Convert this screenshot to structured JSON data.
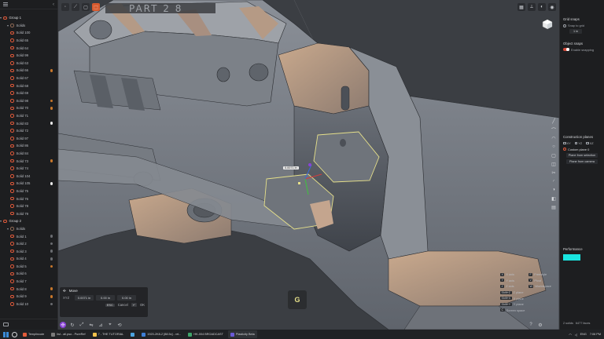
{
  "sidebar": {
    "items": [
      {
        "kind": "group",
        "label": "Group 1",
        "dot": null
      },
      {
        "kind": "sub",
        "label": "Solids",
        "dot": null
      },
      {
        "kind": "solid",
        "label": "Solid 100",
        "dot": null
      },
      {
        "kind": "solid",
        "label": "Solid 65",
        "dot": null
      },
      {
        "kind": "solid",
        "label": "Solid 64",
        "dot": null
      },
      {
        "kind": "solid",
        "label": "Solid 99",
        "dot": null
      },
      {
        "kind": "solid",
        "label": "Solid 63",
        "dot": null
      },
      {
        "kind": "solid",
        "label": "Solid 66",
        "dot": "orange"
      },
      {
        "kind": "solid",
        "label": "Solid 67",
        "dot": null
      },
      {
        "kind": "solid",
        "label": "Solid 68",
        "dot": null
      },
      {
        "kind": "solid",
        "label": "Solid 69",
        "dot": null
      },
      {
        "kind": "solid",
        "label": "Solid 98",
        "dot": "orange"
      },
      {
        "kind": "solid",
        "label": "Solid 70",
        "dot": "orange"
      },
      {
        "kind": "solid",
        "label": "Solid 71",
        "dot": null
      },
      {
        "kind": "solid",
        "label": "Solid 83",
        "dot": "white"
      },
      {
        "kind": "solid",
        "label": "Solid 72",
        "dot": null
      },
      {
        "kind": "solid",
        "label": "Solid 97",
        "dot": null
      },
      {
        "kind": "solid",
        "label": "Solid 86",
        "dot": null
      },
      {
        "kind": "solid",
        "label": "Solid 84",
        "dot": null
      },
      {
        "kind": "solid",
        "label": "Solid 73",
        "dot": "orange"
      },
      {
        "kind": "solid",
        "label": "Solid 74",
        "dot": null
      },
      {
        "kind": "solid",
        "label": "Solid 104",
        "dot": null
      },
      {
        "kind": "solid",
        "label": "Solid 105",
        "dot": "white"
      },
      {
        "kind": "solid",
        "label": "Solid 75",
        "dot": null
      },
      {
        "kind": "solid",
        "label": "Solid 76",
        "dot": null
      },
      {
        "kind": "solid",
        "label": "Solid 78",
        "dot": null
      },
      {
        "kind": "solid",
        "label": "Solid 79",
        "dot": null
      },
      {
        "kind": "group",
        "label": "Group 2",
        "dot": null
      },
      {
        "kind": "sub",
        "label": "Solids",
        "dot": null
      },
      {
        "kind": "solid",
        "label": "Solid 1",
        "dot": "grey"
      },
      {
        "kind": "solid",
        "label": "Solid 2",
        "dot": "grey"
      },
      {
        "kind": "solid",
        "label": "Solid 3",
        "dot": "grey"
      },
      {
        "kind": "solid",
        "label": "Solid 4",
        "dot": "grey"
      },
      {
        "kind": "solid",
        "label": "Solid 5",
        "dot": "orange"
      },
      {
        "kind": "solid",
        "label": "Solid 6",
        "dot": null
      },
      {
        "kind": "solid",
        "label": "Solid 7",
        "dot": null
      },
      {
        "kind": "solid",
        "label": "Solid 8",
        "dot": "orange"
      },
      {
        "kind": "solid",
        "label": "Solid 9",
        "dot": "orange"
      },
      {
        "kind": "solid",
        "label": "Solid 10",
        "dot": "grey"
      }
    ]
  },
  "viewport": {
    "title": "PART 2 8",
    "dimension_label": "0.0071 in",
    "g_key": "G"
  },
  "move_panel": {
    "title": "Move",
    "axis_label": "XYZ",
    "x_value": "0.0071 in",
    "y_value": "0.00 in",
    "z_value": "0.00 in",
    "cancel_key": "ESC",
    "cancel_label": "Cancel",
    "ok_key": "↵",
    "ok_label": "OK"
  },
  "shortcuts": [
    {
      "k1": "X",
      "l1": "X axis",
      "k2": "F",
      "l2": "Freestyle"
    },
    {
      "k1": "Y",
      "l1": "Y axis",
      "k2": "V",
      "l2": "Pivot"
    },
    {
      "k1": "Z",
      "l1": "Z axis",
      "k2": "W",
      "l2": "Worldspace"
    },
    {
      "k1": "Shift+Z",
      "l1": "Z plane",
      "k2": "",
      "l2": ""
    },
    {
      "k1": "Shift+X",
      "l1": "X plane",
      "k2": "",
      "l2": ""
    },
    {
      "k1": "Shift+Y",
      "l1": "Y plane",
      "k2": "",
      "l2": ""
    },
    {
      "k1": "C",
      "l1": "Screen space",
      "k2": "",
      "l2": ""
    }
  ],
  "right_panel": {
    "grid_snaps_title": "Grid snaps",
    "snap_to_grid_label": "Snap to grid",
    "grid_size": "1 in",
    "object_snaps_title": "Object snaps",
    "enable_snapping_label": "Enable snapping",
    "construction_planes_title": "Construction planes",
    "plane_x": "XY",
    "plane_y": "YZ",
    "plane_z": "XZ",
    "custom_plane_label": "Custom plane 0",
    "plane_from_selection": "Plane from selection",
    "plane_from_camera": "Plane from camera",
    "performance_title": "Performance",
    "footer_solids": "2 solids",
    "footer_faces": "6477 faces"
  },
  "taskbar": {
    "apps": [
      {
        "label": "Templincute",
        "color": "#e25c3a",
        "active": false
      },
      {
        "label": "list - all.pso - PureRef",
        "color": "#7a7a7a",
        "active": false
      },
      {
        "label": "7 - THE TUTORIAL",
        "color": "#f2c24b",
        "active": false
      },
      {
        "label": "",
        "color": "#4aa3df",
        "active": false
      },
      {
        "label": "1920-2K8-2 [88.5c] - vrt...",
        "color": "#3f7fd6",
        "active": false
      },
      {
        "label": "HK-004 BROADCAST",
        "color": "#3fa46a",
        "active": false
      },
      {
        "label": "Plasticity Beta",
        "color": "#6a5ad6",
        "active": true
      }
    ],
    "tray_lang": "ENG",
    "tray_time": "7:06 PM"
  },
  "colors": {
    "accent": "#d85a2e",
    "selection": "#e6e08a",
    "performance": "#19e5e0"
  }
}
